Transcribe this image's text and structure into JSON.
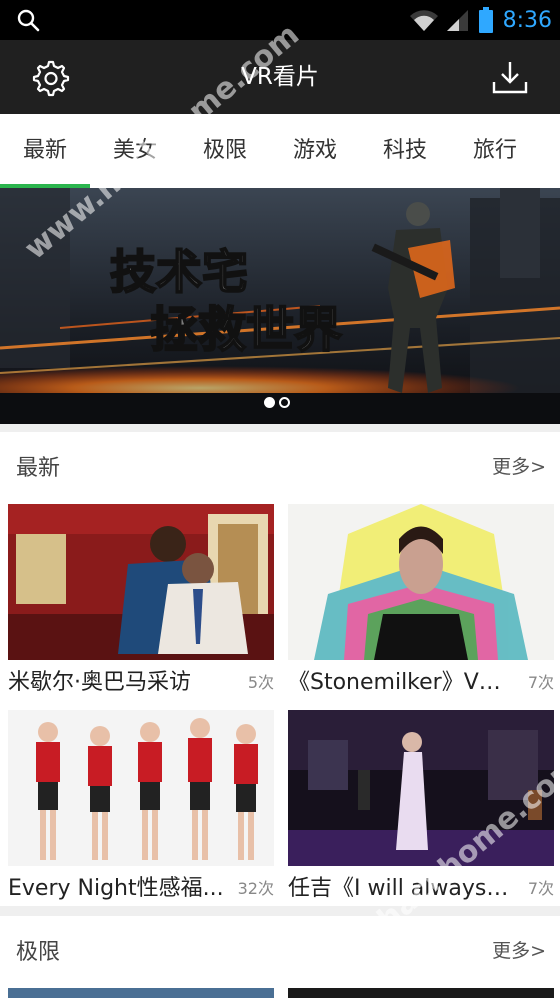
{
  "status_bar": {
    "time": "8:36",
    "icons": [
      "search-icon",
      "wifi-icon",
      "signal-icon",
      "battery-icon"
    ]
  },
  "app_bar": {
    "title": "VR看片",
    "left_icon": "gear-icon",
    "right_icon": "download-icon"
  },
  "tabs": [
    {
      "label": "最新",
      "active": true
    },
    {
      "label": "美女",
      "active": false
    },
    {
      "label": "极限",
      "active": false
    },
    {
      "label": "游戏",
      "active": false
    },
    {
      "label": "科技",
      "active": false
    },
    {
      "label": "旅行",
      "active": false
    }
  ],
  "banner": {
    "headline_line1": "技术宅",
    "headline_line2": "拯救世界",
    "page_count": 2,
    "current_page": 1
  },
  "sections": [
    {
      "title": "最新",
      "more": "更多>",
      "items": [
        {
          "title": "米歇尔·奥巴马采访",
          "views": "5次"
        },
        {
          "title": "《Stonemilker》VR...",
          "views": "7次"
        },
        {
          "title": "Every Night性感福...",
          "views": "32次"
        },
        {
          "title": "任吉《I will always ...",
          "views": "7次"
        }
      ]
    },
    {
      "title": "极限",
      "more": "更多>"
    }
  ],
  "watermark": "www.hackhome.com",
  "colors": {
    "accent": "#2bb54e",
    "app_bar": "#202020",
    "status_time": "#2fa8ff"
  }
}
